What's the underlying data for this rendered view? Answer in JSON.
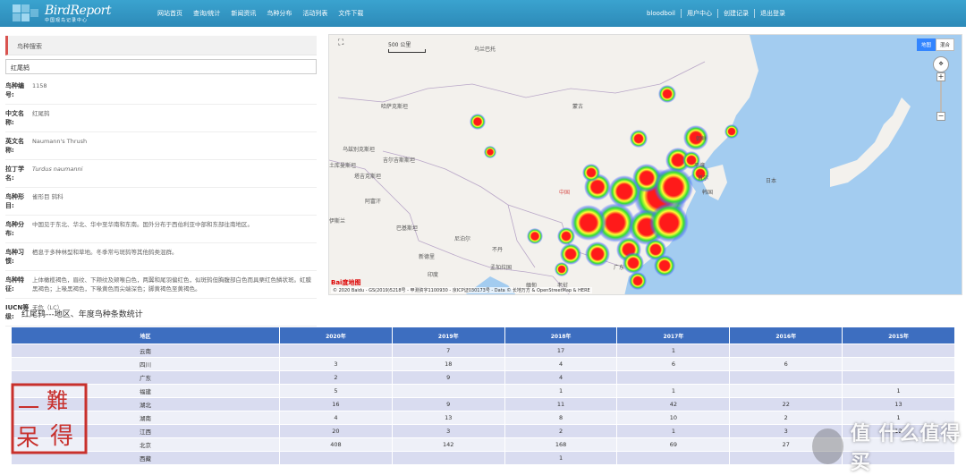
{
  "brand": {
    "logo_text": "BirdReport",
    "logo_sub": "中国观鸟记录中心"
  },
  "nav": {
    "left": [
      "网站首页",
      "查询/统计",
      "新闻资讯",
      "鸟种分布",
      "活动列表",
      "文件下载"
    ],
    "user": "bloodboil",
    "right": [
      "用户中心",
      "创建记录",
      "退出登录"
    ]
  },
  "species_panel": {
    "title": "鸟种搜索",
    "search_value": "红尾鸫",
    "fields": [
      {
        "label": "鸟种编号:",
        "value": "1158"
      },
      {
        "label": "中文名称:",
        "value": "红尾鸫"
      },
      {
        "label": "英文名称:",
        "value": "Naumann's Thrush"
      },
      {
        "label": "拉丁学名:",
        "value": "Turdus naumanni",
        "italic": true
      },
      {
        "label": "鸟种形目:",
        "value": "雀形目 鸫科"
      },
      {
        "label": "鸟种分布:",
        "value": "中国见于东北、华北、华中至华南和东南。国外分布于西伯利亚中部和东部往南地区。"
      },
      {
        "label": "鸟种习惯:",
        "value": "栖息于多种林型和草地。冬季常与斑鸫等其他鸫类混群。"
      },
      {
        "label": "鸟种特征:",
        "value": "上体橄榄褐色，眉纹、下颊纹及颏喉白色，两翼和尾羽偏红色，似斑鸫但胸腹部白色而具栗红色鳞状斑。虹膜黑褐色；上喙黑褐色，下喙黄色而尖端深色；脚黄褐色至黄褐色。"
      },
      {
        "label": "IUCN等级:",
        "value": "无危（LC）"
      }
    ]
  },
  "map": {
    "scale_label": "500 公里",
    "type_buttons": [
      "地图",
      "混合"
    ],
    "active_type": "地图",
    "copyright": "© 2020 Baidu - GS(2019)5218号 - 甲测资字1100930 - 京ICP证030173号 - Data © 长地万方 & OpenStreetMap & HERE",
    "baidu_label": "Bai度地图",
    "labels": [
      {
        "text": "乌兰巴托",
        "region": "mn-capital"
      },
      {
        "text": "哈萨克斯坦",
        "region": "kz"
      },
      {
        "text": "蒙古",
        "region": "mn"
      },
      {
        "text": "乌兹别克斯坦",
        "region": "uz"
      },
      {
        "text": "吉尔吉斯斯坦",
        "region": "kg"
      },
      {
        "text": "塔吉克斯坦",
        "region": "tj"
      },
      {
        "text": "土库曼斯坦",
        "region": "tm"
      },
      {
        "text": "阿富汗",
        "region": "af"
      },
      {
        "text": "巴基斯坦",
        "region": "pk"
      },
      {
        "text": "尼泊尔",
        "region": "np"
      },
      {
        "text": "不丹",
        "region": "bt"
      },
      {
        "text": "孟加拉国",
        "region": "bd"
      },
      {
        "text": "缅甸",
        "region": "mm"
      },
      {
        "text": "老挝",
        "region": "la"
      },
      {
        "text": "中国",
        "region": "cn"
      },
      {
        "text": "朝鲜",
        "region": "kp"
      },
      {
        "text": "韩国",
        "region": "kr"
      },
      {
        "text": "日本",
        "region": "jp"
      },
      {
        "text": "首尔",
        "region": "kr-capital"
      },
      {
        "text": "平壤",
        "region": "kp-capital"
      },
      {
        "text": "新德里",
        "region": "in-capital"
      },
      {
        "text": "印度",
        "region": "in"
      },
      {
        "text": "广东",
        "region": "gd"
      },
      {
        "text": "伊斯兰",
        "region": "pk-capital"
      }
    ]
  },
  "stats": {
    "title": "红尾鸫---地区、年度鸟种条数统计",
    "columns": [
      "地区",
      "2020年",
      "2019年",
      "2018年",
      "2017年",
      "2016年",
      "2015年"
    ],
    "rows": [
      [
        "云南",
        "",
        "7",
        "17",
        "1",
        "",
        ""
      ],
      [
        "四川",
        "3",
        "18",
        "4",
        "6",
        "6",
        ""
      ],
      [
        "广东",
        "2",
        "9",
        "4",
        "",
        "",
        ""
      ],
      [
        "福建",
        "5",
        "",
        "1",
        "1",
        "",
        "1"
      ],
      [
        "湖北",
        "16",
        "9",
        "11",
        "42",
        "22",
        "13"
      ],
      [
        "湖南",
        "4",
        "13",
        "8",
        "10",
        "2",
        "1"
      ],
      [
        "江西",
        "20",
        "3",
        "2",
        "1",
        "3",
        "12"
      ],
      [
        "北京",
        "408",
        "142",
        "168",
        "69",
        "27",
        ""
      ],
      [
        "西藏",
        "",
        "",
        "1",
        "",
        "",
        ""
      ]
    ]
  },
  "overlay": {
    "stamp_chars": [
      "難",
      "得",
      "一",
      "呆"
    ],
    "watermark": "值 什么值得买"
  },
  "colors": {
    "nav": "#2d8ab8",
    "table_header": "#3d6ec0",
    "heat_hot": "#ff1a1a",
    "heat_mid": "#ffff33",
    "heat_cool": "#33dd33",
    "heat_outer": "#4466ff",
    "sea": "#a3ccf0"
  }
}
